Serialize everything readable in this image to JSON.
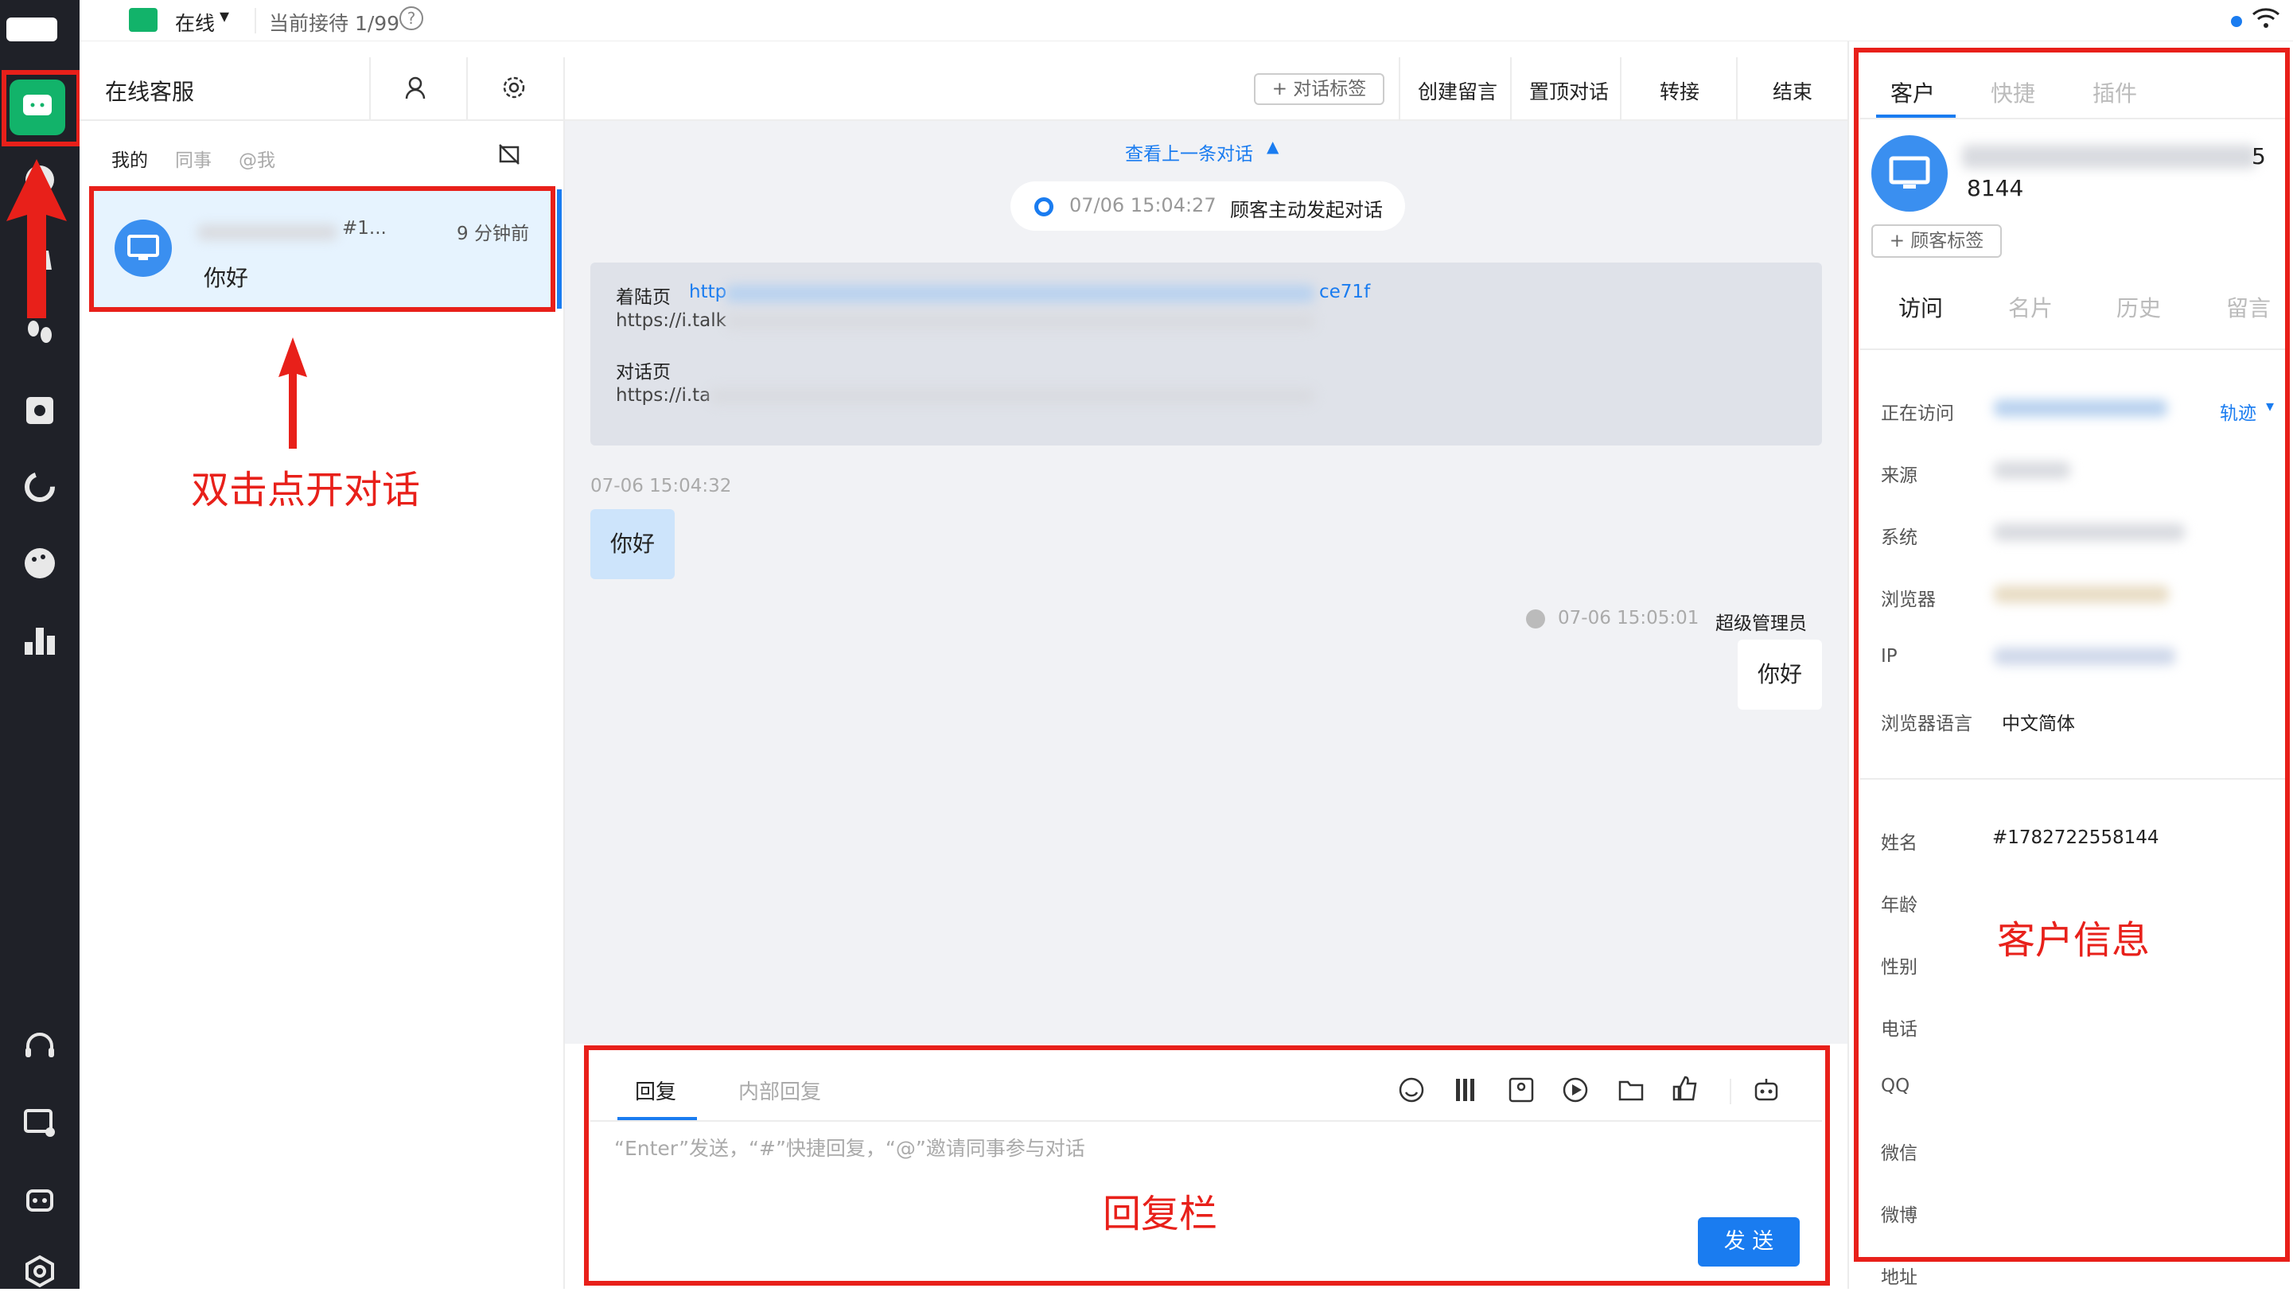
{
  "topbar": {
    "status": "在线",
    "current_label": "当前接待 1/99",
    "help": "?"
  },
  "sessions_panel": {
    "title": "在线客服",
    "tabs": [
      "我的",
      "同事",
      "@我"
    ],
    "session": {
      "id": "#1...",
      "time": "9 分钟前",
      "message": "你好"
    }
  },
  "chat_toolbar": {
    "tag_btn": "+ 对话标签",
    "leave_msg": "创建留言",
    "pin": "置顶对话",
    "transfer": "转接",
    "end": "结束"
  },
  "chat": {
    "prev": "查看上一条对话",
    "system_time": "07/06 15:04:27",
    "system_text": "顾客主动发起对话",
    "landing_label": "着陆页",
    "landing_prefix": "http",
    "landing_suffix": "ce71f",
    "landing_line2": "https://i.talk",
    "chat_page_label": "对话页",
    "chat_page_line": "https://i.ta",
    "cust_time": "07-06 15:04:32",
    "cust_msg": "你好",
    "agent_time": "07-06 15:05:01",
    "agent_name": "超级管理员",
    "agent_msg": "你好"
  },
  "reply": {
    "tab_reply": "回复",
    "tab_internal": "内部回复",
    "placeholder": "“Enter”发送，“#”快捷回复，“@”邀请同事参与对话",
    "send": "发 送"
  },
  "customer": {
    "tabs": [
      "客户",
      "快捷",
      "插件"
    ],
    "name_tail": "5",
    "id_short": "8144",
    "tag_btn": "+ 顾客标签",
    "sub_tabs": [
      "访问",
      "名片",
      "历史",
      "留言"
    ],
    "visit_fields": [
      "正在访问",
      "来源",
      "系统",
      "浏览器",
      "IP",
      "浏览器语言"
    ],
    "trail": "轨迹",
    "browser_lang": "中文简体",
    "card_fields": [
      "姓名",
      "年龄",
      "性别",
      "电话",
      "QQ",
      "微信",
      "微博",
      "地址"
    ],
    "name_value": "#1782722558144"
  },
  "annotations": {
    "dblclick": "双击点开对话",
    "reply_bar": "回复栏",
    "customer_info": "客户信息"
  },
  "colors": {
    "accent": "#1a7cf0",
    "rail": "#1f2128",
    "green": "#12b36a",
    "annot": "#e8201a"
  }
}
